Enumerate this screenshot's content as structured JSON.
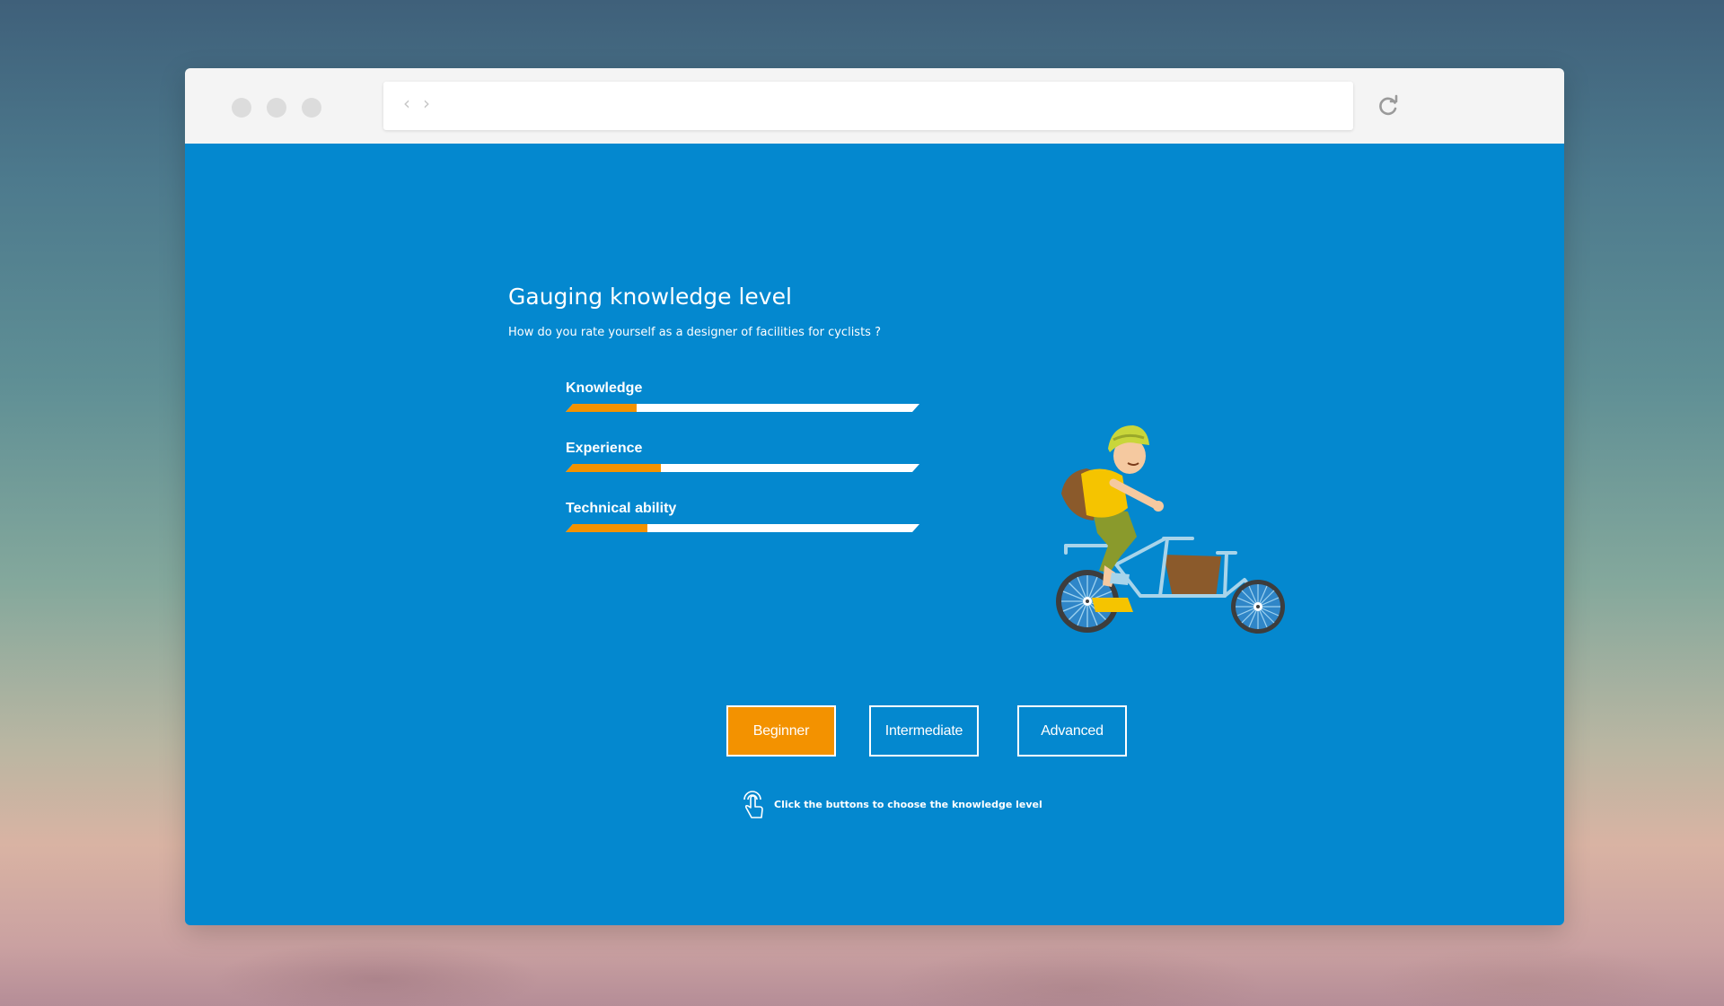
{
  "colors": {
    "content_bg": "#0488cf",
    "accent": "#f39200",
    "text": "#ffffff",
    "titlebar_bg": "#f4f4f4"
  },
  "browser": {
    "back_icon": "chevron-left-icon",
    "forward_icon": "chevron-right-icon",
    "reload_icon": "reload-icon",
    "url": ""
  },
  "page": {
    "title": "Gauging knowledge level",
    "subtitle": "How do you rate yourself as a designer of facilities for cyclists ?"
  },
  "skills": [
    {
      "label": "Knowledge",
      "fill_fraction": 0.2
    },
    {
      "label": "Experience",
      "fill_fraction": 0.27
    },
    {
      "label": "Technical ability",
      "fill_fraction": 0.23
    }
  ],
  "levels": {
    "selected": "Beginner",
    "options": [
      "Beginner",
      "Intermediate",
      "Advanced"
    ]
  },
  "hint": {
    "icon": "tap-hand-icon",
    "text": "Click the buttons to choose the knowledge level"
  }
}
